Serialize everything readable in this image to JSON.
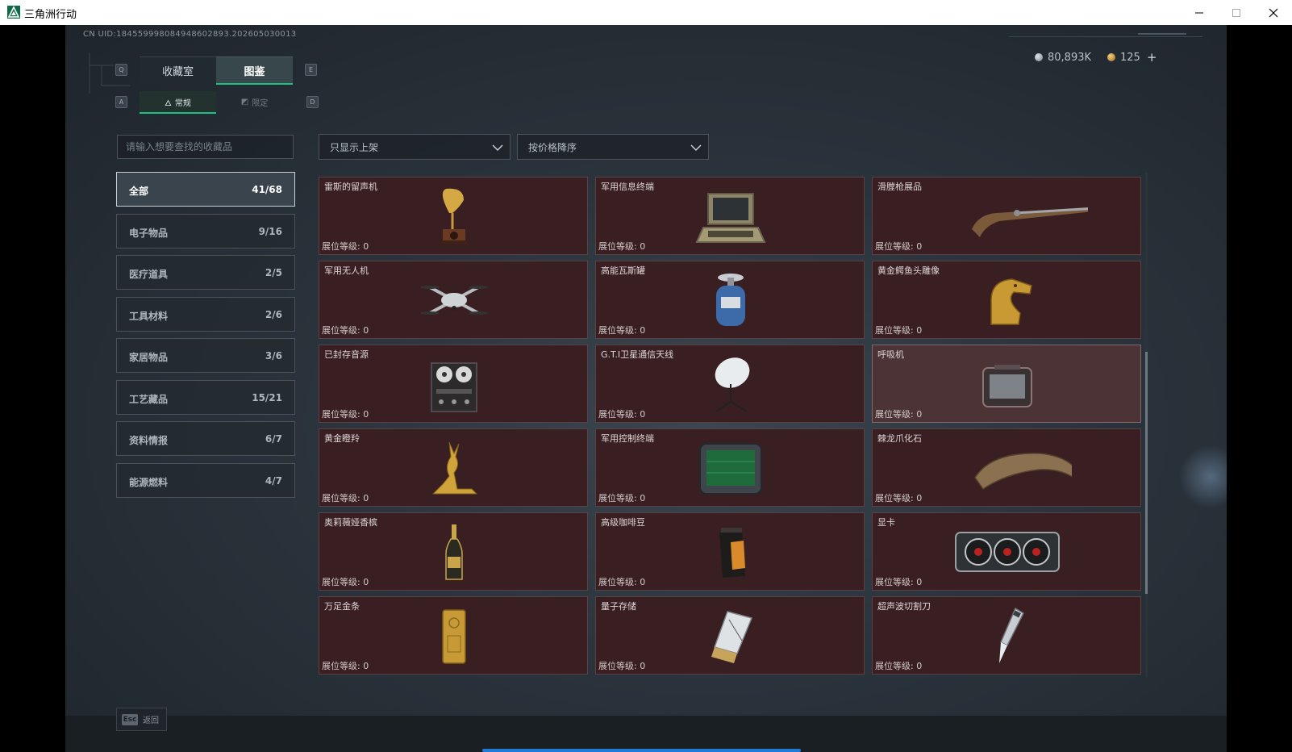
{
  "window": {
    "title": "三角洲行动"
  },
  "header": {
    "uid": "CN UID:184559998084948602893.202605030013",
    "currency_silver": "80,893K",
    "currency_gold": "125",
    "currency_plus": "+"
  },
  "keys": {
    "prev_tab": "Q",
    "next_tab": "E",
    "prev_sub": "A",
    "next_sub": "D"
  },
  "tabs": {
    "collection": "收藏室",
    "codex": "图鉴"
  },
  "subtabs": {
    "normal": "常规",
    "limited": "限定"
  },
  "search": {
    "placeholder": "请输入想要查找的收藏品"
  },
  "filters": {
    "shelf": "只显示上架",
    "sort": "按价格降序"
  },
  "categories": [
    {
      "name": "全部",
      "count": "41/68"
    },
    {
      "name": "电子物品",
      "count": "9/16"
    },
    {
      "name": "医疗道具",
      "count": "2/5"
    },
    {
      "name": "工具材料",
      "count": "2/6"
    },
    {
      "name": "家居物品",
      "count": "3/6"
    },
    {
      "name": "工艺藏品",
      "count": "15/21"
    },
    {
      "name": "资料情报",
      "count": "6/7"
    },
    {
      "name": "能源燃料",
      "count": "4/7"
    }
  ],
  "level_label": "展位等级:",
  "items": [
    {
      "name": "雷斯的留声机",
      "level": "0",
      "icon": "gramophone-icon"
    },
    {
      "name": "军用信息终端",
      "level": "0",
      "icon": "military-terminal-icon"
    },
    {
      "name": "滑膛枪展品",
      "level": "0",
      "icon": "musket-icon"
    },
    {
      "name": "军用无人机",
      "level": "0",
      "icon": "drone-icon"
    },
    {
      "name": "高能瓦斯罐",
      "level": "0",
      "icon": "gas-canister-icon"
    },
    {
      "name": "黄金鳄鱼头雕像",
      "level": "0",
      "icon": "gold-crocodile-icon"
    },
    {
      "name": "已封存音源",
      "level": "0",
      "icon": "reel-recorder-icon"
    },
    {
      "name": "G.T.I卫星通信天线",
      "level": "0",
      "icon": "satellite-dish-icon"
    },
    {
      "name": "呼吸机",
      "level": "0",
      "icon": "ventilator-icon"
    },
    {
      "name": "黄金瞪羚",
      "level": "0",
      "icon": "gold-gazelle-icon"
    },
    {
      "name": "军用控制终端",
      "level": "0",
      "icon": "control-terminal-icon"
    },
    {
      "name": "棘龙爪化石",
      "level": "0",
      "icon": "claw-fossil-icon"
    },
    {
      "name": "奥莉薇娅香槟",
      "level": "0",
      "icon": "champagne-icon"
    },
    {
      "name": "高级咖啡豆",
      "level": "0",
      "icon": "coffee-bag-icon"
    },
    {
      "name": "显卡",
      "level": "0",
      "icon": "graphics-card-icon"
    },
    {
      "name": "万足金条",
      "level": "0",
      "icon": "gold-bar-icon"
    },
    {
      "name": "量子存储",
      "level": "0",
      "icon": "quantum-storage-icon"
    },
    {
      "name": "超声波切割刀",
      "level": "0",
      "icon": "ultrasonic-knife-icon"
    }
  ],
  "footer": {
    "esc_key": "Esc",
    "esc_label": "返回"
  },
  "colors": {
    "accent": "#1fbf83",
    "card_bg": "#3a1f22",
    "progress": "#1f7bd6"
  }
}
